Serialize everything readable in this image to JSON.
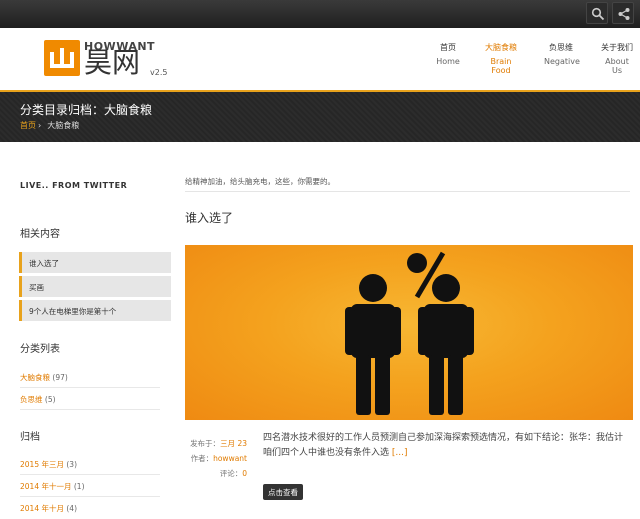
{
  "topbar": {
    "icons": [
      "search-icon",
      "share-icon"
    ]
  },
  "header": {
    "logo_en": "HOWWANT",
    "logo_cn": "昊网",
    "version": "v2.5",
    "nav": [
      {
        "cn": "首页",
        "en": "Home"
      },
      {
        "cn": "大脑食粮",
        "en": "Brain Food"
      },
      {
        "cn": "负思维",
        "en": "Negative"
      },
      {
        "cn": "关于我们",
        "en": "About Us"
      }
    ]
  },
  "band": {
    "title": "分类目录归档：大脑食粮",
    "crumb_home": "首页",
    "crumb_sep": "›",
    "crumb_current": "大脑食粮"
  },
  "sidebar": {
    "twitter_heading": "LIVE.. FROM TWITTER",
    "related_heading": "相关内容",
    "related": [
      "谁入选了",
      "买画",
      "9个人在电梯里你是第十个"
    ],
    "categories_heading": "分类列表",
    "categories": [
      {
        "name": "大脑食粮",
        "count": "(97)"
      },
      {
        "name": "负思维",
        "count": "(5)"
      }
    ],
    "archive_heading": "归档",
    "archives": [
      {
        "name": "2015 年三月",
        "count": "(3)"
      },
      {
        "name": "2014 年十一月",
        "count": "(1)"
      },
      {
        "name": "2014 年十月",
        "count": "(4)"
      }
    ]
  },
  "main": {
    "tagline": "给精神加油，给头脑充电，这些，你需要的。",
    "post_title": "谁入选了",
    "meta": {
      "posted_label": "发布于：",
      "posted_date": "三月 23",
      "author_label": "作者：",
      "author": "howwant",
      "comments_label": "评论：",
      "comments": "0"
    },
    "excerpt": "四名潜水技术很好的工作人员预测自己参加深海探索预选情况，有如下结论：张华：我估计咱们四个人中谁也没有条件入选",
    "more": "[...]",
    "read_more": "点击查看"
  },
  "colors": {
    "accent": "#e8a21c",
    "link": "#e07b00",
    "band": "#2a2a2a"
  }
}
